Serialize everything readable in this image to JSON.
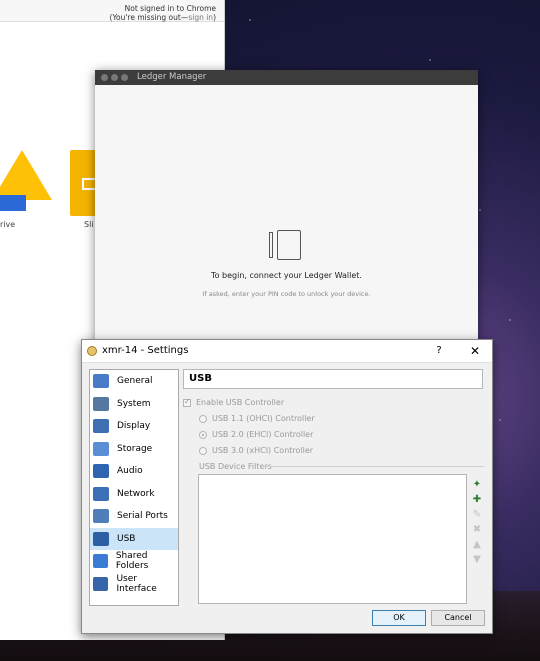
{
  "chrome": {
    "status_line1": "Not signed in to Chrome",
    "status_line2_a": "(You're missing out—",
    "status_line2_link": "sign in",
    "status_line2_b": ")",
    "app1_label": "rive",
    "app2_label": "Sli"
  },
  "ledger": {
    "title": "Ledger Manager",
    "message": "To begin, connect your Ledger Wallet.",
    "submessage": "If asked, enter your PIN code to unlock your device."
  },
  "vbox": {
    "title": "xmr-14 - Settings",
    "help_label": "?",
    "close_label": "✕",
    "sidebar": [
      {
        "label": "General",
        "icon": "general-icon",
        "color": "#4a7bc9"
      },
      {
        "label": "System",
        "icon": "system-icon",
        "color": "#5577a0"
      },
      {
        "label": "Display",
        "icon": "display-icon",
        "color": "#3f6fb3"
      },
      {
        "label": "Storage",
        "icon": "storage-icon",
        "color": "#5a8fd6"
      },
      {
        "label": "Audio",
        "icon": "audio-icon",
        "color": "#2f65b0"
      },
      {
        "label": "Network",
        "icon": "network-icon",
        "color": "#3c6fb5"
      },
      {
        "label": "Serial Ports",
        "icon": "serial-ports-icon",
        "color": "#4e7fba"
      },
      {
        "label": "USB",
        "icon": "usb-icon",
        "color": "#2d5fa4"
      },
      {
        "label": "Shared Folders",
        "icon": "shared-folders-icon",
        "color": "#3a7bd5"
      },
      {
        "label": "User Interface",
        "icon": "user-interface-icon",
        "color": "#3665a8"
      }
    ],
    "active_index": 7,
    "page_title": "USB",
    "enable_usb": {
      "label": "Enable USB Controller",
      "checked": true
    },
    "controllers": [
      {
        "label": "USB 1.1 (OHCI) Controller",
        "checked": false
      },
      {
        "label": "USB 2.0 (EHCI) Controller",
        "checked": true
      },
      {
        "label": "USB 3.0 (xHCI) Controller",
        "checked": false
      }
    ],
    "filters_label": "USB Device Filters",
    "tools": [
      {
        "icon": "add-empty-filter-icon",
        "glyph": "✦",
        "enabled": true
      },
      {
        "icon": "add-filter-from-device-icon",
        "glyph": "✚",
        "enabled": true
      },
      {
        "icon": "edit-filter-icon",
        "glyph": "✎",
        "enabled": false
      },
      {
        "icon": "remove-filter-icon",
        "glyph": "✖",
        "enabled": false
      },
      {
        "icon": "move-filter-up-icon",
        "glyph": "▲",
        "enabled": false
      },
      {
        "icon": "move-filter-down-icon",
        "glyph": "▼",
        "enabled": false
      }
    ],
    "ok_label": "OK",
    "cancel_label": "Cancel"
  }
}
